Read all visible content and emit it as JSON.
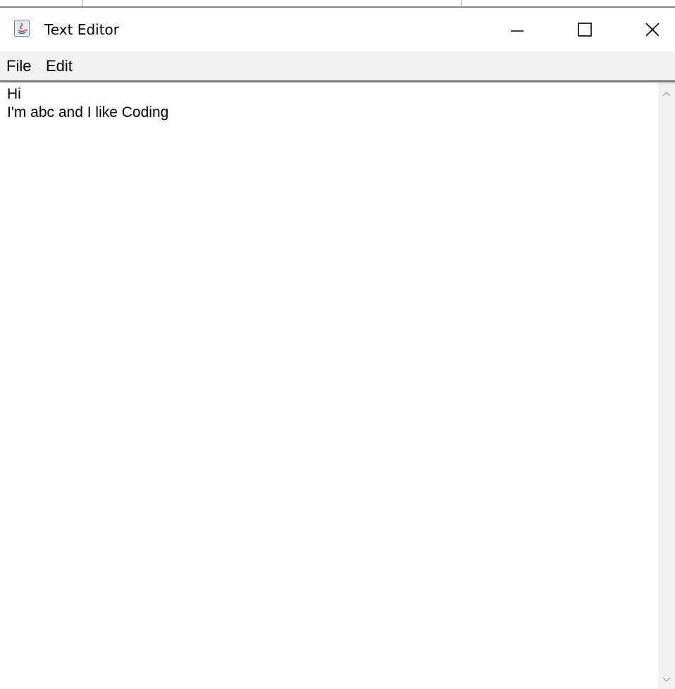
{
  "window": {
    "title": "Text Editor",
    "app_icon": "java-coffee-cup-icon",
    "controls": {
      "minimize_icon": "minimize-icon",
      "maximize_icon": "maximize-icon",
      "close_icon": "close-icon"
    }
  },
  "menubar": {
    "items": [
      {
        "label": "File"
      },
      {
        "label": "Edit"
      }
    ]
  },
  "editor": {
    "lines": [
      "Hi",
      "I'm abc and I like Coding"
    ]
  },
  "scrollbar": {
    "up_icon": "chevron-up-icon",
    "down_icon": "chevron-down-icon"
  },
  "colors": {
    "menubar_bg": "#f0f0f0",
    "window_bg": "#ffffff",
    "scrollbar_bg": "#f0f0f0",
    "text": "#000000"
  }
}
